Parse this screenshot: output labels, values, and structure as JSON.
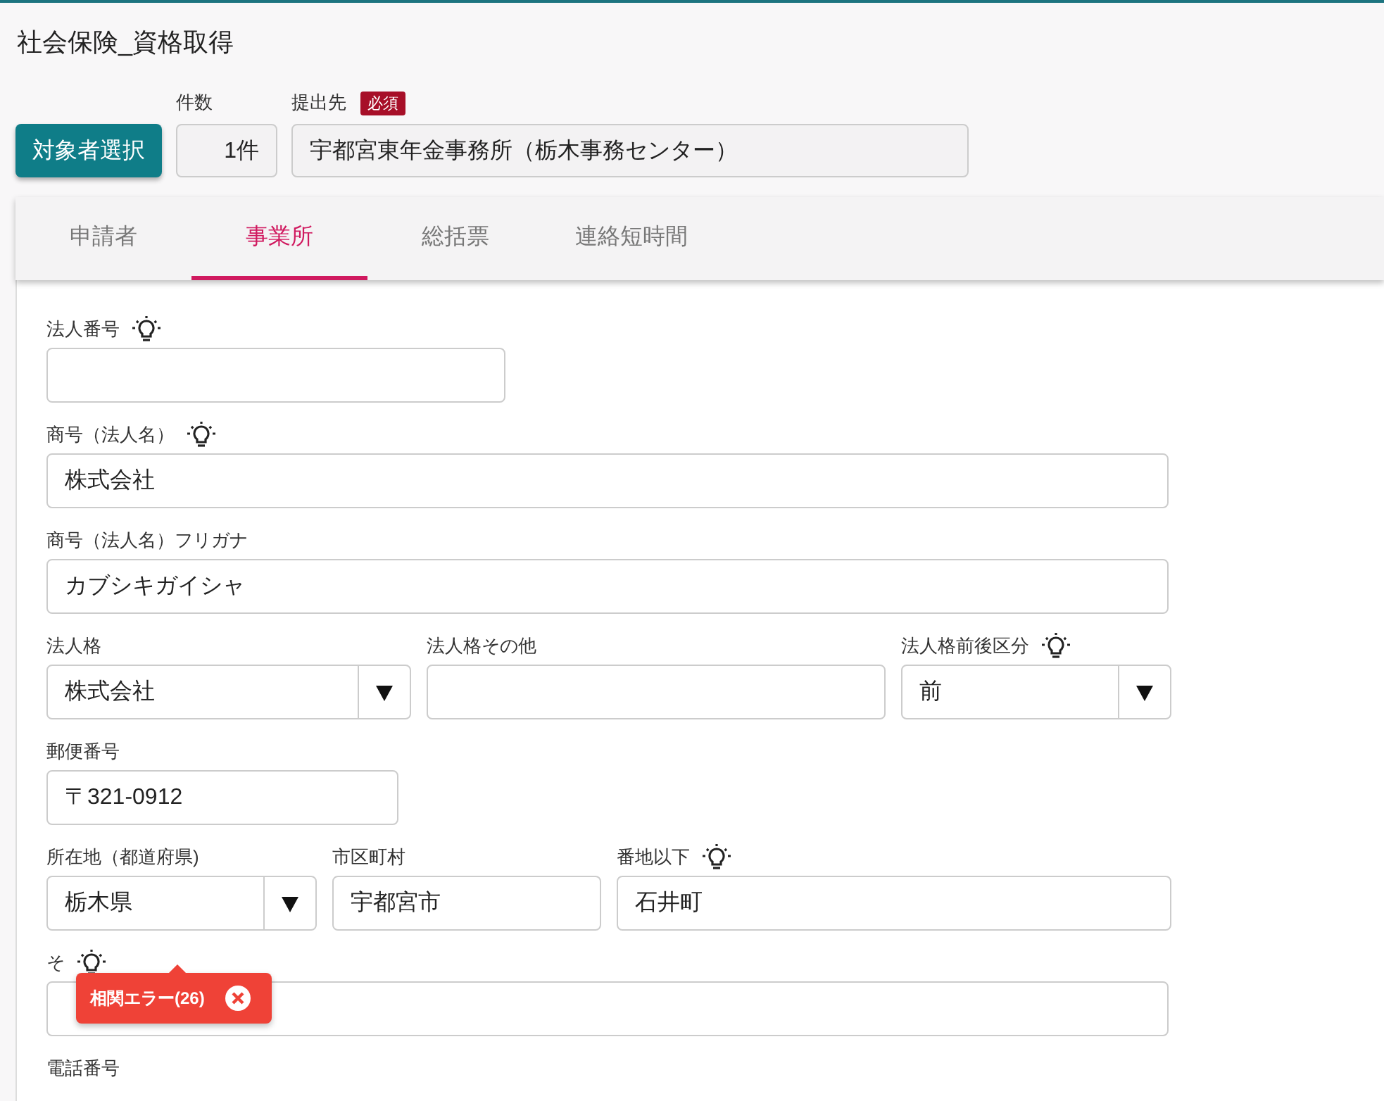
{
  "page_title": "社会保険_資格取得",
  "select_button": "対象者選択",
  "count": {
    "label": "件数",
    "value": "1件"
  },
  "destination": {
    "label": "提出先",
    "badge": "必須",
    "value": "宇都宮東年金事務所（栃木事務センター）"
  },
  "tabs": [
    {
      "label": "申請者",
      "selected": false
    },
    {
      "label": "事業所",
      "selected": true
    },
    {
      "label": "総括票",
      "selected": false
    },
    {
      "label": "連絡短時間",
      "selected": false
    }
  ],
  "form_rows": [
    {
      "fields": [
        {
          "label": "法人番号",
          "hint": true,
          "kind": "text"
        }
      ]
    },
    {
      "fields": [
        {
          "label": "商号（法人名）",
          "hint": true,
          "kind": "text",
          "value": "株式会社"
        }
      ]
    },
    {
      "fields": [
        {
          "label": "商号（法人名）フリガナ",
          "hint": false,
          "kind": "text",
          "value": "カブシキガイシャ"
        }
      ]
    },
    {
      "fields": [
        {
          "label": "法人格",
          "hint": false,
          "kind": "select",
          "value": "株式会社"
        },
        {
          "label": "法人格その他",
          "hint": false,
          "kind": "text"
        },
        {
          "label": "法人格前後区分",
          "hint": true,
          "kind": "select",
          "value": "前"
        }
      ]
    },
    {
      "fields": [
        {
          "label": "郵便番号",
          "hint": false,
          "kind": "text",
          "value": "〒321-0912"
        }
      ]
    },
    {
      "fields": [
        {
          "label": "所在地（都道府県)",
          "hint": false,
          "kind": "select",
          "value": "栃木県"
        },
        {
          "label": "市区町村",
          "hint": false,
          "kind": "text",
          "value": "宇都宮市"
        },
        {
          "label": "番地以下",
          "hint": true,
          "kind": "text",
          "value": "石井町"
        }
      ]
    },
    {
      "fields": [
        {
          "label": "そ",
          "hint": true,
          "kind": "text"
        }
      ]
    },
    {
      "fields": [
        {
          "label": "電話番号",
          "hint": false,
          "kind": "label"
        }
      ]
    }
  ],
  "error_popup": {
    "text": "相関エラー(26)"
  }
}
